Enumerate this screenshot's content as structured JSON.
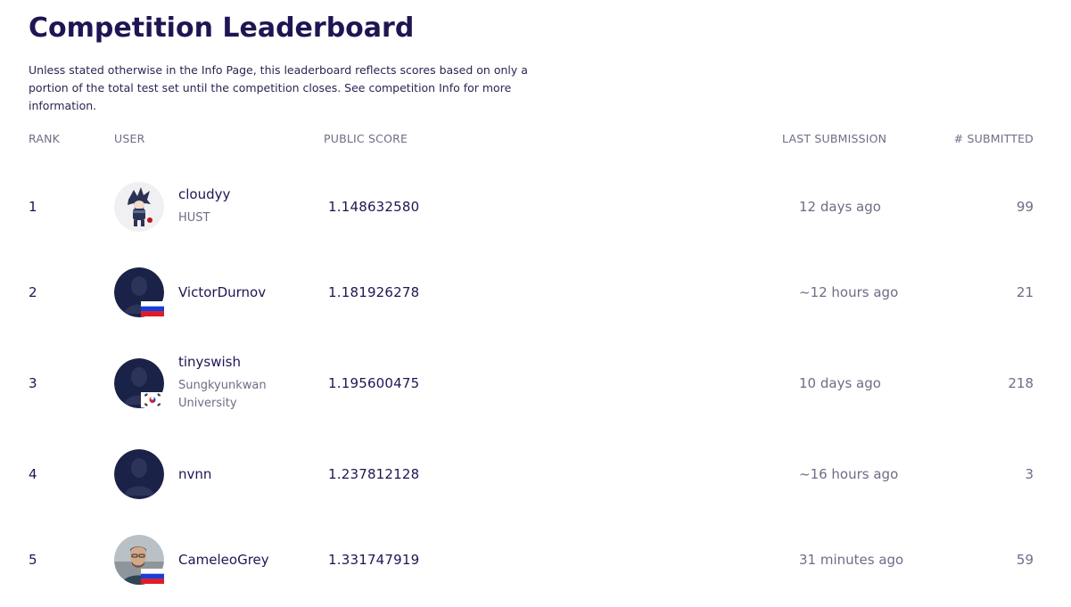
{
  "page": {
    "title": "Competition Leaderboard",
    "description": "Unless stated otherwise in the Info Page, this leaderboard reflects scores based on only a portion of the total test set until the competition closes. See competition Info for more information."
  },
  "table": {
    "headers": {
      "rank": "RANK",
      "user": "USER",
      "score": "PUBLIC SCORE",
      "last": "LAST SUBMISSION",
      "submitted": "# SUBMITTED"
    },
    "rows": [
      {
        "rank": "1",
        "name": "cloudyy",
        "org": "HUST",
        "score": "1.148632580",
        "last": "12 days ago",
        "submitted": "99",
        "avatar_icon": "anime-character-avatar",
        "flag": ""
      },
      {
        "rank": "2",
        "name": "VictorDurnov",
        "org": "",
        "score": "1.181926278",
        "last": "~12 hours ago",
        "submitted": "21",
        "avatar_icon": "default-user-avatar",
        "flag": "russia-flag"
      },
      {
        "rank": "3",
        "name": "tinyswish",
        "org": "Sungkyunkwan University",
        "score": "1.195600475",
        "last": "10 days ago",
        "submitted": "218",
        "avatar_icon": "default-user-avatar",
        "flag": "south-korea-flag"
      },
      {
        "rank": "4",
        "name": "nvnn",
        "org": "",
        "score": "1.237812128",
        "last": "~16 hours ago",
        "submitted": "3",
        "avatar_icon": "default-user-avatar",
        "flag": ""
      },
      {
        "rank": "5",
        "name": "CameleoGrey",
        "org": "",
        "score": "1.331747919",
        "last": "31 minutes ago",
        "submitted": "59",
        "avatar_icon": "user-photo-avatar",
        "flag": "russia-flag"
      }
    ]
  },
  "colors": {
    "title": "#1e1653",
    "muted": "#6f6c86",
    "avatar_bg": "#1b2248"
  }
}
